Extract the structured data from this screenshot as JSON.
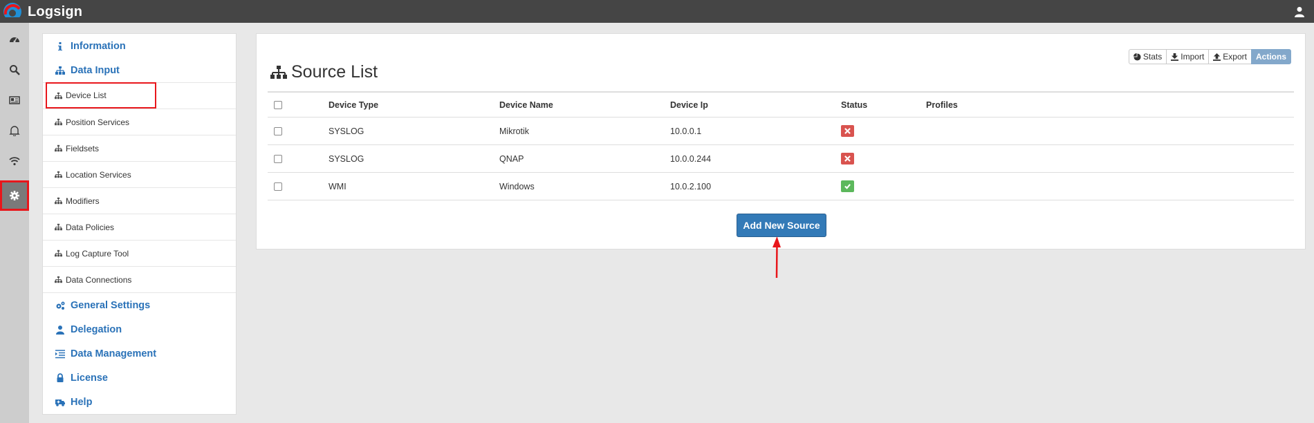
{
  "app": {
    "brand": "Logsign"
  },
  "colors": {
    "topbar": "#454545",
    "accent": "#2a72b8",
    "primary_button": "#337ab7",
    "status_bad": "#d9534f",
    "status_ok": "#5cb85c",
    "highlight": "#e8161b"
  },
  "rail": [
    {
      "icon": "dashboard-icon"
    },
    {
      "icon": "search-icon"
    },
    {
      "icon": "report-card-icon"
    },
    {
      "icon": "bell-icon"
    },
    {
      "icon": "wifi-icon"
    },
    {
      "icon": "gear-icon",
      "active": true
    }
  ],
  "sidebar": {
    "information": "Information",
    "data_input": "Data Input",
    "items": [
      {
        "label": "Device List",
        "active": true
      },
      {
        "label": "Position Services"
      },
      {
        "label": "Fieldsets"
      },
      {
        "label": "Location Services"
      },
      {
        "label": "Modifiers"
      },
      {
        "label": "Data Policies"
      },
      {
        "label": "Log Capture Tool"
      },
      {
        "label": "Data Connections"
      }
    ],
    "general_settings": "General Settings",
    "delegation": "Delegation",
    "data_management": "Data Management",
    "license": "License",
    "help": "Help"
  },
  "toolbar": {
    "stats": "Stats",
    "import": "Import",
    "export": "Export",
    "actions": "Actions"
  },
  "main": {
    "title": "Source List",
    "columns": {
      "type": "Device Type",
      "name": "Device Name",
      "ip": "Device Ip",
      "status": "Status",
      "profiles": "Profiles"
    },
    "rows": [
      {
        "type": "SYSLOG",
        "name": "Mikrotik",
        "ip": "10.0.0.1",
        "status": "error"
      },
      {
        "type": "SYSLOG",
        "name": "QNAP",
        "ip": "10.0.0.244",
        "status": "error"
      },
      {
        "type": "WMI",
        "name": "Windows",
        "ip": "10.0.2.100",
        "status": "ok"
      }
    ],
    "add_button": "Add New Source"
  }
}
